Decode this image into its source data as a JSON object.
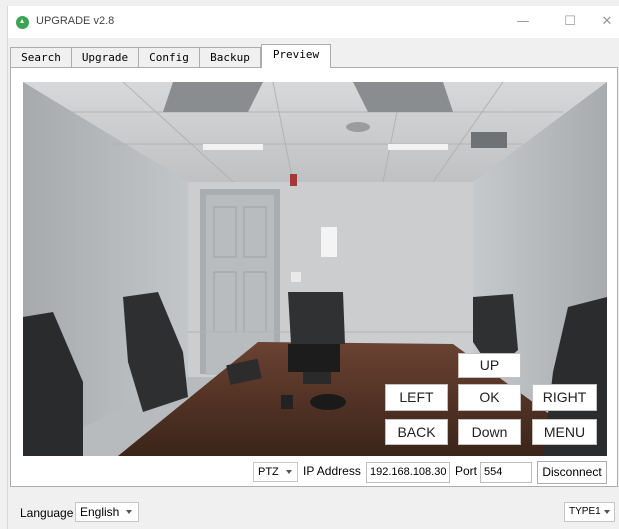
{
  "window": {
    "title": "UPGRADE v2.8",
    "minimize": "—",
    "maximize": "☐",
    "close": "✕"
  },
  "tabs": [
    "Search",
    "Upgrade",
    "Config",
    "Backup",
    "Preview"
  ],
  "ptz": {
    "up": "UP",
    "left": "LEFT",
    "ok": "OK",
    "right": "RIGHT",
    "back": "BACK",
    "down": "Down",
    "menu": "MENU"
  },
  "connection": {
    "mode": "PTZ",
    "ip_label": "IP Address",
    "ip_value": "192.168.108.30",
    "port_label": "Port",
    "port_value": "554",
    "disconnect": "Disconnect"
  },
  "footer": {
    "language_label": "Language",
    "language_value": "English",
    "type_value": "TYPE1"
  },
  "icons": {
    "app": "upload-arrow-icon",
    "dropdown": "chevron-down-icon"
  },
  "colors": {
    "app_icon": "#3aa655"
  }
}
